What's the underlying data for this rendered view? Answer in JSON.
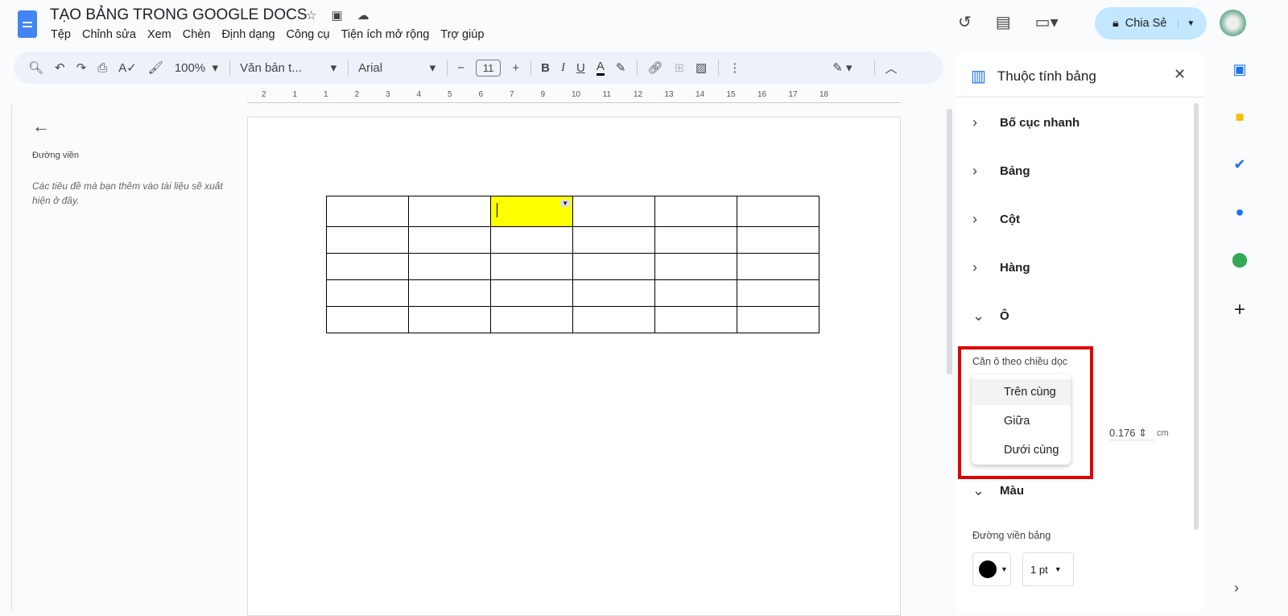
{
  "doc": {
    "title": "TẠO BẢNG TRONG GOOGLE DOCS",
    "menu": [
      "Tệp",
      "Chỉnh sửa",
      "Xem",
      "Chèn",
      "Định dạng",
      "Công cụ",
      "Tiện ích mở rộng",
      "Trợ giúp"
    ]
  },
  "header": {
    "share_label": "Chia Sẻ"
  },
  "toolbar": {
    "zoom": "100%",
    "style": "Văn bản t...",
    "font": "Arial",
    "font_size": "11"
  },
  "ruler": [
    "2",
    "1",
    "1",
    "2",
    "3",
    "4",
    "5",
    "6",
    "7",
    "9",
    "10",
    "11",
    "12",
    "13",
    "14",
    "15",
    "16",
    "17",
    "18"
  ],
  "outline": {
    "title": "Đường viền",
    "empty_text": "Các tiêu đề mà bạn thêm vào tài liệu sẽ xuất hiện ở đây."
  },
  "panel": {
    "title": "Thuộc tính bảng",
    "sections": [
      "Bố cục nhanh",
      "Bảng",
      "Cột",
      "Hàng",
      "Ô",
      "Màu"
    ],
    "valign_label": "Căn ô theo chiều dọc",
    "valign_options": [
      "Trên cùng",
      "Giữa",
      "Dưới cùng"
    ],
    "padding_value": "0.176",
    "padding_unit": "cm",
    "border_label": "Đường viền bảng",
    "border_width": "1 pt"
  },
  "colors": {
    "highlight": "#ffff00",
    "accent": "#1a73e8",
    "share_bg": "#c2e7ff",
    "annotation": "#e00000"
  }
}
